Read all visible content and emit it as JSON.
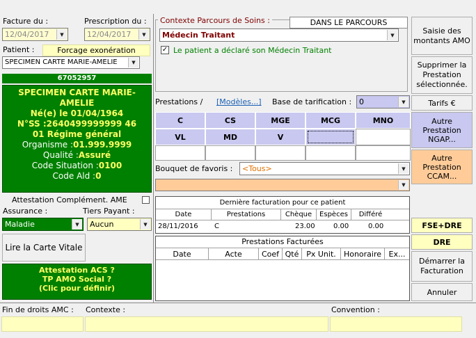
{
  "left": {
    "facture_label": "Facture du :",
    "facture_date": "12/04/2017",
    "prescription_label": "Prescription du :",
    "prescription_date": "12/04/2017",
    "patient_label": "Patient :",
    "forcage_button": "Forcage exonération",
    "patient_select": "SPECIMEN CARTE MARIE-AMELIE",
    "patient_number": "67052957",
    "card": {
      "name_line1": "SPECIMEN CARTE MARIE-",
      "name_line2": "AMELIE",
      "born": "Né(e) le 01/04/1964",
      "nss": "N°SS :2640499999999 46",
      "regime": "01 Régime général",
      "organisme_label": "Organisme :",
      "organisme_value": "01.999.9999",
      "qualite_label": "Qualité :",
      "qualite_value": "Assuré",
      "code_situation_label": "Code Situation :",
      "code_situation_value": "0100",
      "code_ald_label": "Code Ald :",
      "code_ald_value": "0"
    },
    "attestation_ame_label": "Attestation Complément. AME",
    "assurance_label": "Assurance :",
    "assurance_value": "Maladie",
    "tiers_payant_label": "Tiers Payant :",
    "tiers_payant_value": "Aucun",
    "lire_carte_button": "Lire la Carte Vitale",
    "acs_line1": "Attestation ACS ?",
    "acs_line2": "TP AMO Social ?",
    "acs_line3": "(Clic pour définir)"
  },
  "context": {
    "title": "Contexte Parcours de Soins",
    "parcours_status": "DANS LE PARCOURS",
    "medecin_select": "Médecin Traitant",
    "declared_checkbox_label": "Le patient a déclaré son Médecin Traitant"
  },
  "prestations": {
    "label": "Prestations /",
    "modeles_link": "[Modèles...]",
    "base_label": "Base de tarification :",
    "base_value": "0",
    "row1": [
      "C",
      "CS",
      "MGE",
      "MCG",
      "MNO"
    ],
    "row2": [
      "VL",
      "MD",
      "V",
      "",
      ""
    ],
    "bouquet_label": "Bouquet de favoris :",
    "bouquet_value": "<Tous>"
  },
  "derniere": {
    "title": "Dernière facturation pour ce patient",
    "headers": [
      "Date",
      "Prestations",
      "Chèque",
      "Espèces",
      "Différé"
    ],
    "row": [
      "28/11/2016",
      "C",
      "23.00",
      "0.00",
      "0.00"
    ]
  },
  "facturees": {
    "title": "Prestations Facturées",
    "headers": [
      "Date",
      "Acte",
      "Coef",
      "Qté",
      "Px Unit.",
      "Honoraire",
      "Ex..."
    ]
  },
  "right_buttons": {
    "saisie": "Saisie des montants AMO",
    "supprimer": "Supprimer la Prestation sélectionnée.",
    "tarifs": "Tarifs €",
    "ngap": "Autre Prestation NGAP...",
    "ccam": "Autre Prestation CCAM...",
    "fse_dre": "FSE+DRE",
    "dre": "DRE",
    "demarrer": "Démarrer la Facturation",
    "annuler": "Annuler"
  },
  "bottom": {
    "fin_droits_label": "Fin de droits AMC :",
    "contexte_label": "Contexte :",
    "convention_label": "Convention :"
  },
  "colors": {
    "green": "#008000",
    "yellow_text": "#ffff66",
    "prestation_blue": "#c8c8f0",
    "ngap_blue": "#c8c8f0",
    "ccam_orange": "#ffcc99",
    "field_yellow": "#ffffc0"
  }
}
